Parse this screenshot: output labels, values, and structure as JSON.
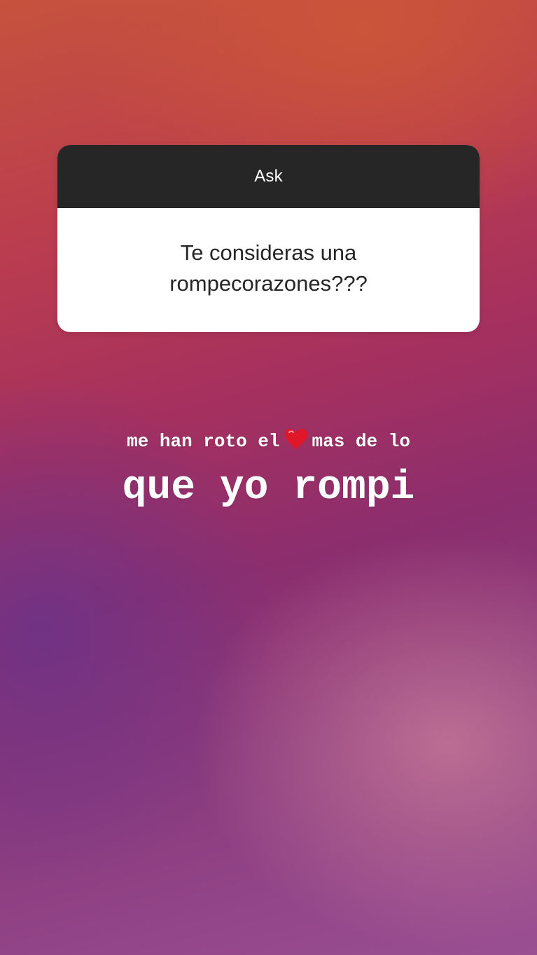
{
  "ask_sticker": {
    "header_label": "Ask",
    "question": "Te consideras una rompecorazones???"
  },
  "answer": {
    "line1_before": "me han roto el",
    "line1_emoji": "heart-icon",
    "line1_after": "mas de lo",
    "line2": "que yo rompi"
  },
  "colors": {
    "card_header": "#262626",
    "card_body": "#ffffff",
    "question_text": "#262626",
    "answer_text": "#ffffff",
    "heart": "#e0162b"
  }
}
